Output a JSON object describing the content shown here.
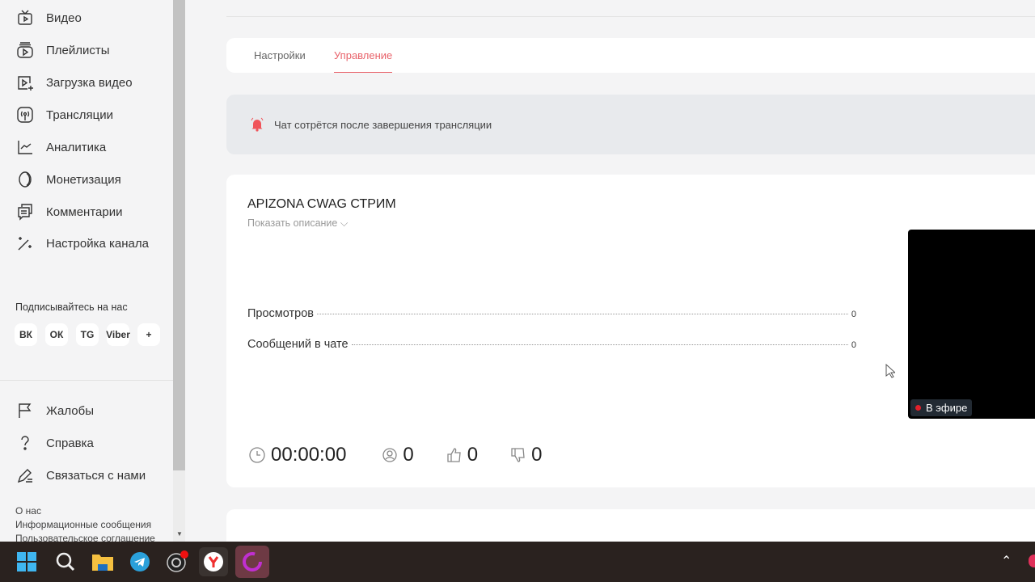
{
  "sidebar": {
    "items": [
      {
        "label": "Видео",
        "icon": "tv-icon"
      },
      {
        "label": "Плейлисты",
        "icon": "playlist-icon"
      },
      {
        "label": "Загрузка видео",
        "icon": "upload-video-icon"
      },
      {
        "label": "Трансляции",
        "icon": "broadcast-icon"
      },
      {
        "label": "Аналитика",
        "icon": "analytics-icon"
      },
      {
        "label": "Монетизация",
        "icon": "coin-icon"
      },
      {
        "label": "Комментарии",
        "icon": "comments-icon"
      },
      {
        "label": "Настройка канала",
        "icon": "magic-wand-icon"
      }
    ],
    "follow_label": "Подписывайтесь на нас",
    "socials": [
      "ВК",
      "ОК",
      "TG",
      "Viber",
      "+"
    ],
    "bottom_items": [
      {
        "label": "Жалобы",
        "icon": "flag-icon"
      },
      {
        "label": "Справка",
        "icon": "question-icon"
      },
      {
        "label": "Связаться с нами",
        "icon": "pen-icon"
      }
    ],
    "footer_links": [
      "О нас",
      "Информационные сообщения",
      "Пользовательское соглашение"
    ]
  },
  "tabs": [
    {
      "label": "Настройки"
    },
    {
      "label": "Управление",
      "active": true
    }
  ],
  "alert": {
    "text": "Чат сотрётся после завершения трансляции",
    "color": "#f0545a"
  },
  "stream": {
    "title": "APIZONA CWAG СТРИМ",
    "show_description": "Показать описание",
    "rows": [
      {
        "label": "Просмотров",
        "value": "0"
      },
      {
        "label": "Сообщений в чате",
        "value": "0"
      }
    ],
    "duration": "00:00:00",
    "viewers": "0",
    "likes": "0",
    "dislikes": "0",
    "live_label": "В эфире"
  },
  "accent": "#e8626a"
}
